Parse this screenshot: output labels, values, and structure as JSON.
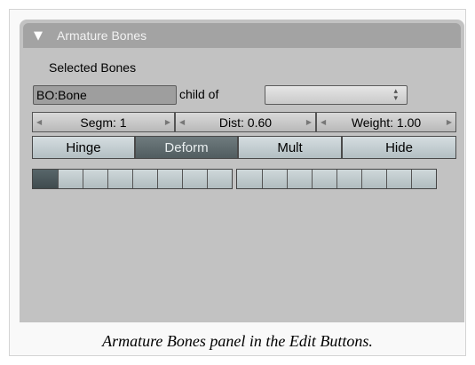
{
  "panel": {
    "title": "Armature Bones",
    "collapse_glyph": "▼",
    "selected_label": "Selected Bones",
    "bone_name": "BO:Bone",
    "child_of_label": "child of",
    "parent_value": ""
  },
  "numeric_fields": {
    "segm": "Segm: 1",
    "dist": "Dist: 0.60",
    "weight": "Weight: 1.00"
  },
  "toggles": {
    "hinge": "Hinge",
    "deform": "Deform",
    "mult": "Mult",
    "hide": "Hide",
    "deform_active": true
  },
  "layers": {
    "group1_active": [
      true,
      false,
      false,
      false,
      false,
      false,
      false,
      false
    ],
    "group2_active": [
      false,
      false,
      false,
      false,
      false,
      false,
      false,
      false
    ]
  },
  "caption": "Armature Bones panel in the Edit Buttons."
}
